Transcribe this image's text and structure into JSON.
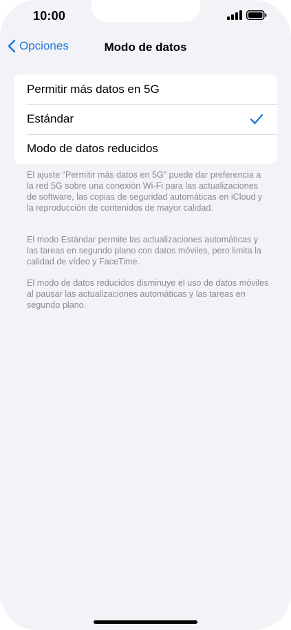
{
  "status_bar": {
    "time": "10:00"
  },
  "nav": {
    "back_label": "Opciones",
    "title": "Modo de datos"
  },
  "options": [
    {
      "label": "Permitir más datos en 5G",
      "selected": false
    },
    {
      "label": "Estándar",
      "selected": true
    },
    {
      "label": "Modo de datos reducidos",
      "selected": false
    }
  ],
  "descriptions": {
    "more_data_5g": "El ajuste “Permitir más datos en 5G” puede dar preferencia a la red 5G sobre una conexión Wi-Fi para las actualizaciones de software, las copias de seguridad automáticas en iCloud y la reproducción de contenidos de mayor calidad.",
    "standard": "El modo Estándar permite las actualizaciones automáticas y las tareas en segundo plano con datos móviles, pero limita la calidad de vídeo y FaceTime.",
    "low_data": "El modo de datos reducidos disminuye el uso de datos móviles al pausar las actualizaciones automáticas y las tareas en segundo plano."
  },
  "icons": {
    "back": "chevron-left-icon",
    "selected": "checkmark-icon",
    "signal": "cellular-signal-icon",
    "battery": "battery-icon"
  },
  "colors": {
    "accent": "#1f7ad8",
    "background": "#f2f2f7",
    "card": "#ffffff",
    "secondary_text": "#8a8a8f"
  }
}
